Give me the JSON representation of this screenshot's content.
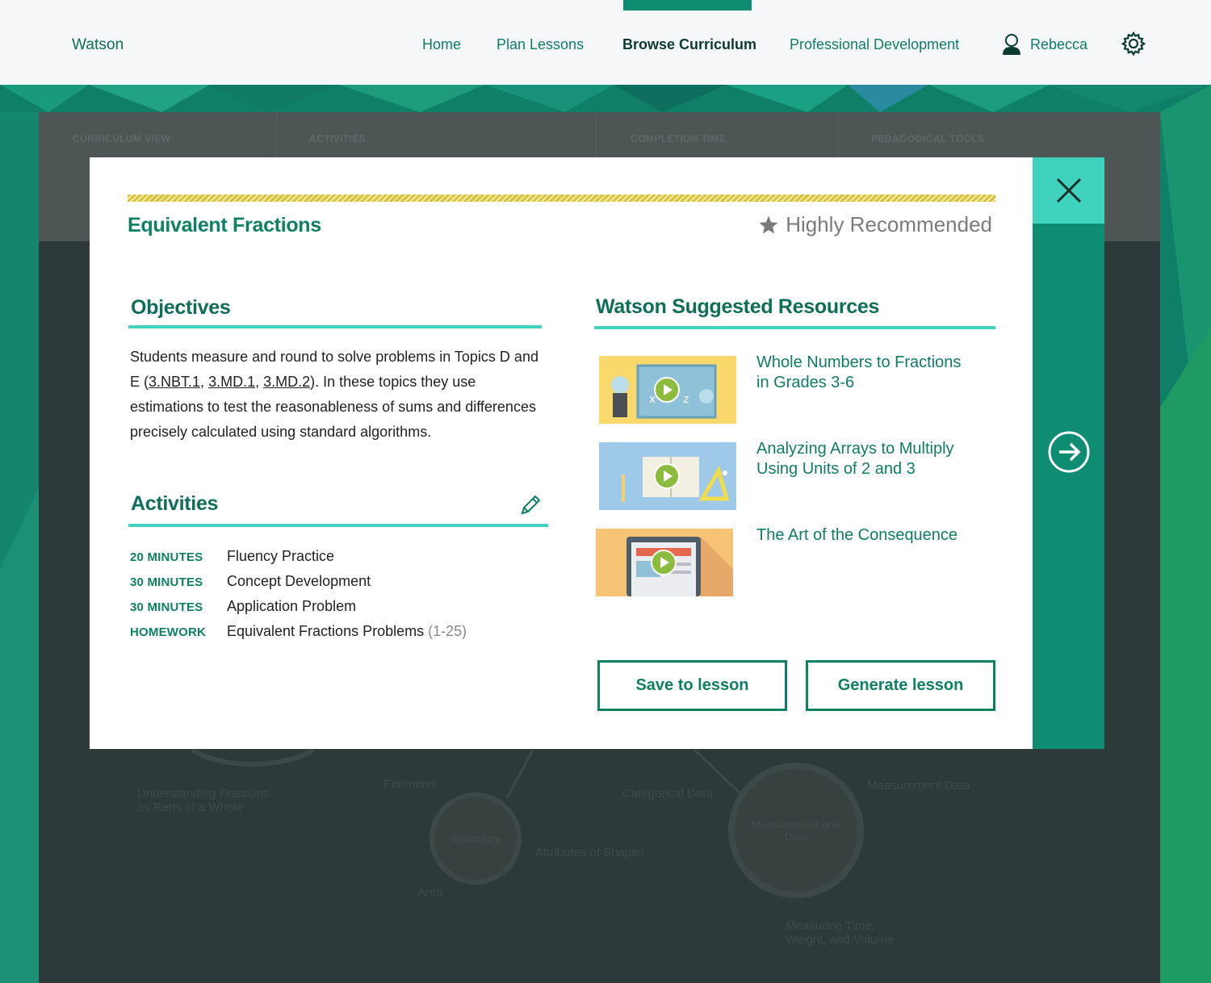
{
  "nav": {
    "brand": "Watson",
    "items": [
      "Home",
      "Plan Lessons",
      "Browse Curriculum",
      "Professional Development"
    ],
    "active": "Browse Curriculum",
    "user_name": "Rebecca"
  },
  "background": {
    "filters": [
      "CURRICULUM VIEW",
      "ACTIVITIES",
      "COMPLETION TIME",
      "PEDAGOGICAL TOOLS"
    ],
    "nodes": [
      "Geometry",
      "Measurement and Data"
    ],
    "topics": [
      "Understanding Fractions as Parts of a Whole",
      "Perimeter",
      "Attributes of Shapes",
      "Area",
      "Categorical Data",
      "Measurement Data",
      "Measuring Time, Weight, and Volume"
    ]
  },
  "modal": {
    "title": "Equivalent Fractions",
    "recommendation": "Highly Recommended",
    "objectives": {
      "heading": "Objectives",
      "text_before": "Students measure and round to solve problems in Topics D and E (",
      "standards": [
        "3.NBT.1",
        "3.MD.1",
        "3.MD.2"
      ],
      "text_after": ").  In these topics they use estimations to test the reasonableness of sums and differences precisely calculated using standard algorithms."
    },
    "activities": {
      "heading": "Activities",
      "items": [
        {
          "duration": "20 MINUTES",
          "name": "Fluency Practice",
          "extra": ""
        },
        {
          "duration": "30 MINUTES",
          "name": "Concept Development",
          "extra": ""
        },
        {
          "duration": "30 MINUTES",
          "name": "Application Problem",
          "extra": ""
        },
        {
          "duration": "HOMEWORK",
          "name": "Equivalent Fractions Problems",
          "extra": "(1-25)"
        }
      ]
    },
    "resources": {
      "heading": "Watson Suggested Resources",
      "items": [
        {
          "title": "Whole Numbers to Fractions in Grades 3-6",
          "thumb_color": "#f9d96c"
        },
        {
          "title": "Analyzing Arrays to Multiply Using Units of 2 and 3",
          "thumb_color": "#9fc9e9"
        },
        {
          "title": "The Art of the Consequence",
          "thumb_color": "#f7c476"
        }
      ]
    },
    "buttons": {
      "save": "Save to lesson",
      "generate": "Generate lesson"
    }
  },
  "colors": {
    "brand_green": "#0e8064",
    "accent_teal": "#3fd3bd",
    "hatch_yellow": "#d8c23c"
  }
}
